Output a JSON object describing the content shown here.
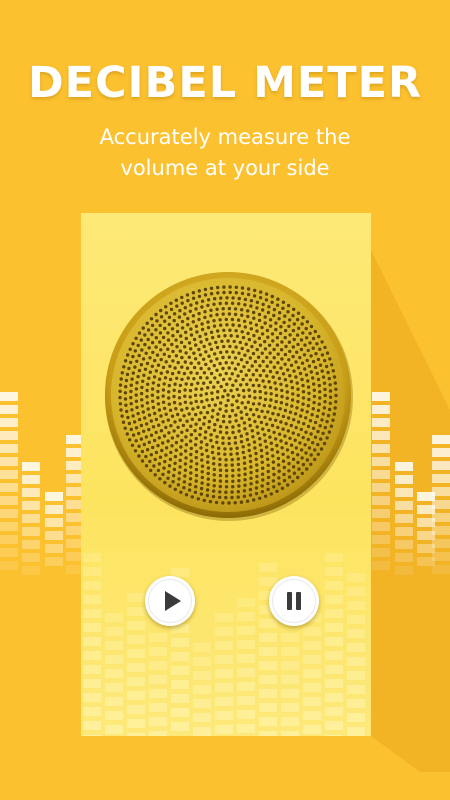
{
  "header": {
    "title": "DECIBEL METER",
    "subtitle_line1": "Accurately measure the",
    "subtitle_line2": "volume at your side"
  },
  "controls": {
    "play_icon": "play-icon",
    "pause_icon": "pause-icon"
  },
  "colors": {
    "background": "#fcc12f",
    "panel": "#fce35c",
    "speaker_gold": "#c9a321",
    "white": "#ffffff"
  }
}
